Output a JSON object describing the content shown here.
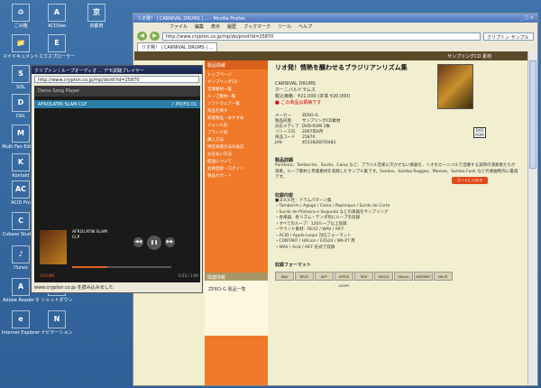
{
  "desktop": {
    "icons": [
      {
        "label": "ごみ箱",
        "glyph": "♻"
      },
      {
        "label": "ACDSee",
        "glyph": "A"
      },
      {
        "label": "京都府",
        "glyph": "京"
      },
      {
        "label": "マイドキュメント",
        "glyph": "📁"
      },
      {
        "label": "エクスプローラー",
        "glyph": "E"
      },
      {
        "label": "SOL",
        "glyph": "S"
      },
      {
        "label": "DVL",
        "glyph": "D"
      },
      {
        "label": "Multi Fan Edition",
        "glyph": "M"
      },
      {
        "label": "Kontakt",
        "glyph": "K"
      },
      {
        "label": "ACID Pro",
        "glyph": "AC"
      },
      {
        "label": "Cubase Studio 4",
        "glyph": "C"
      },
      {
        "label": "iTunes",
        "glyph": "♪"
      },
      {
        "label": "Windows Media Player",
        "glyph": "▶"
      },
      {
        "label": "Adobe Reader 9",
        "glyph": "A"
      },
      {
        "label": "シャットダウン",
        "glyph": "⏻"
      },
      {
        "label": "Internet Explorer",
        "glyph": "e"
      },
      {
        "label": "ナビゲーション",
        "glyph": "N"
      }
    ]
  },
  "browser": {
    "title": "リオ発！ | CARNIVAL DRUMS | ... - Mozilla Firefox",
    "controls": "_ □ ×",
    "menu": [
      "ファイル",
      "編集",
      "表示",
      "履歴",
      "ブックマーク",
      "ツール",
      "ヘルプ"
    ],
    "address": "http://www.crypton.co.jp/mp/do/prod?id=25870",
    "search_placeholder": "クリプトン サンプル",
    "tab": "リオ発！ | CARNIVAL DRUMS | ...",
    "topbar_text": "サンプリングCD 素材"
  },
  "page": {
    "side_head": "製品情報",
    "side_items": [
      "トップページ",
      "サンプリングCD",
      "音源素材一覧",
      "ループ素材一覧",
      "ソフトウェア一覧",
      "商品を探す",
      "新着製品・おすすめ",
      "ジャンル別",
      "ブランド別",
      "購入方法",
      "特定商取引法の表記",
      "お支払い方法",
      "配送について",
      "会員登録・ログイン",
      "製品サポート"
    ],
    "side_sub_head": "関連情報",
    "side_sub_item": "ZERO-G 製品一覧",
    "product_title": "リオ発！情熱を醸わせるブラジリアンリズム集",
    "product_name": "CARNIVAL DRUMS",
    "product_kana": "カーニバルドラムス",
    "price": "税込価格：¥21,000 (本体 ¥20,000)",
    "stock": "■ この商品は即納です",
    "specs": [
      {
        "k": "メーカー",
        "v": "ZERO-G"
      },
      {
        "k": "製品形態",
        "v": "サンプリングCD素材"
      },
      {
        "k": "対応メディア",
        "v": "DVD-ROM 1枚"
      },
      {
        "k": "リリース日",
        "v": "2007年6月"
      },
      {
        "k": "商品コード",
        "v": "25870"
      },
      {
        "k": "JAN",
        "v": "4511820070483"
      }
    ],
    "dvd_label": "DVD ROM",
    "buy_label": "カートに入れる",
    "sec1": "製品詳細",
    "para1": "Pandeiro、Tamborim、Surdo、Caixa など、ブラジル音楽に欠かせない楽器を、リオのカーニバルで活躍する実際の演奏者たちが演奏。ループ素材と単発素材を収録したサンプル集です。Samba、Samba Reggae、Maxixe、Samba Funk などの楽曲制作に最適です。",
    "sec2": "収録内容",
    "contents": [
      "■ヨエル社：ドラムパターン集",
      "・Tamborim / Agogo / Caixa / Repinique / Surdo de Corte",
      "・Surdo de Primeira e Segunda などの楽器をサンプリング",
      "・各楽器、各リズム・テンポ別にループを収録",
      "・すべてのループ：120ループ以上収録",
      "・サウンド素材：REX2 / WAV / AIFF",
      "・ACID / Apple Loops 対応フォーマット",
      "・CONTAKT / HALion / EXS24 / NN-XT 用",
      "・WAV / Acid / AIFF 形式で収録"
    ],
    "sec3": "収録フォーマット",
    "formats": [
      "WAV",
      "REX2",
      "AIFF",
      "APPLE LOOPS",
      "REX",
      "EXS24",
      "HALion",
      "KONTAKT",
      "NN-XT"
    ]
  },
  "player": {
    "title": "クリプトン / ループオーディオ ... デモ試聴プレイヤー",
    "address": "http://www.crypton.co.jp/mp/do/dl?id=25870",
    "header": "Demo Song Player",
    "track_name": "AFROLATIN SLAM CLP",
    "track_code": "♪ PD/FD.01",
    "now_title": "AFROLATIN SLAM",
    "now_sub": "CLP",
    "vol_label": "VOLUME",
    "time_label": "0:23 / 1:09",
    "progress": 0.35,
    "status": "www.crypton.co.jp を読み込みました"
  }
}
